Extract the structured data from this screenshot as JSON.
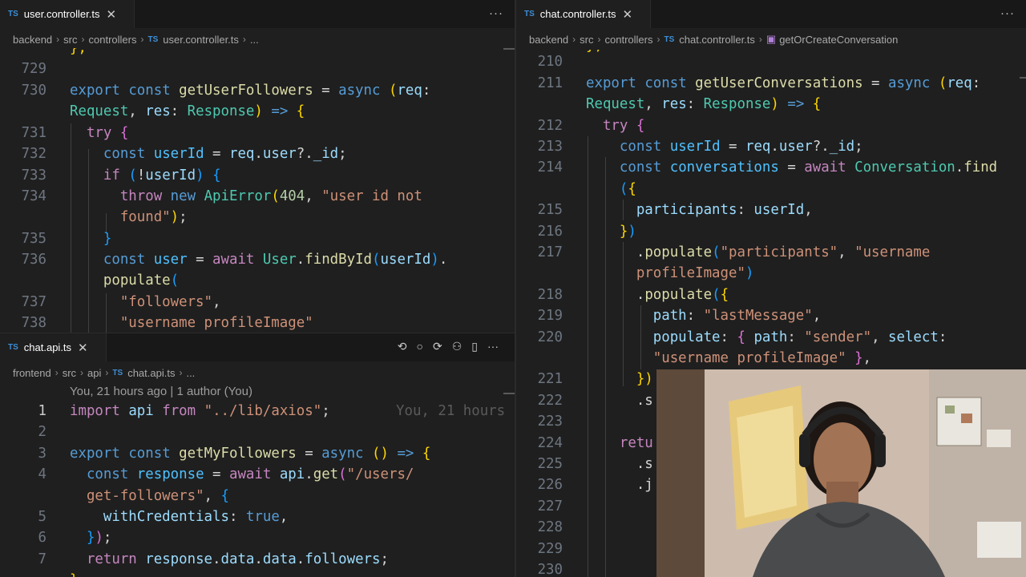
{
  "left_top": {
    "tab": {
      "lang": "TS",
      "name": "user.controller.ts",
      "close": "✕"
    },
    "more": "···",
    "breadcrumb": [
      "backend",
      "src",
      "controllers",
      "TS",
      "user.controller.ts",
      "..."
    ]
  },
  "left_bottom": {
    "tab": {
      "lang": "TS",
      "name": "chat.api.ts",
      "close": "✕"
    },
    "breadcrumb": [
      "frontend",
      "src",
      "api",
      "TS",
      "chat.api.ts",
      "..."
    ],
    "blame": "You, 21 hours ago | 1 author (You)",
    "inline_blame": "You, 21 hours",
    "actions": [
      "⟲",
      "○",
      "⟳",
      "⚇",
      "▯",
      "···"
    ]
  },
  "right": {
    "tab": {
      "lang": "TS",
      "name": "chat.controller.ts",
      "close": "✕"
    },
    "more": "···",
    "breadcrumb": [
      "backend",
      "src",
      "controllers",
      "TS",
      "chat.controller.ts",
      "getOrCreateConversation"
    ]
  },
  "line_numbers": {
    "left_top": [
      "729",
      "730",
      "",
      "731",
      "732",
      "733",
      "734",
      "",
      "735",
      "736",
      "",
      "737",
      "738"
    ],
    "left_bottom": [
      "1",
      "2",
      "3",
      "4",
      "",
      "5",
      "6",
      "7"
    ],
    "right": [
      "210",
      "211",
      "",
      "212",
      "213",
      "214",
      "",
      "215",
      "216",
      "217",
      "",
      "218",
      "219",
      "220",
      "",
      "221",
      "222",
      "223",
      "224",
      "225",
      "226",
      "227",
      "228",
      "229",
      "230"
    ]
  },
  "code": {
    "lt_0": "};",
    "lt_1a": "export",
    "lt_1b": "const",
    "lt_1c": "getUserFollowers",
    "lt_1d": " = ",
    "lt_1e": "async",
    "lt_1f": "(",
    "lt_1g": "req",
    "lt_2a": "Request",
    "lt_2b": ", ",
    "lt_2c": "res",
    "lt_2d": "Response",
    "lt_2e": ")",
    "lt_2f": "=>",
    "lt_2g": "{",
    "lt_3a": "try",
    "lt_3b": "{",
    "lt_4a": "const",
    "lt_4b": "userId",
    "lt_4c": "req",
    "lt_4d": "user",
    "lt_4e": "_id",
    "lt_5a": "if",
    "lt_5b": "(",
    "lt_5c": "!",
    "lt_5d": "userId",
    "lt_5e": ")",
    "lt_5f": "{",
    "lt_6a": "throw",
    "lt_6b": "new",
    "lt_6c": "ApiError",
    "lt_6d": "(",
    "lt_6e": "404",
    "lt_6f": "\"user id not",
    "lt_7a": "found\"",
    "lt_7b": ")",
    "lt_8a": "}",
    "lt_9a": "const",
    "lt_9b": "user",
    "lt_9c": "await",
    "lt_9d": "User",
    "lt_9e": "findById",
    "lt_9f": "(",
    "lt_9g": "userId",
    "lt_9h": ")",
    "lt_10a": "populate",
    "lt_10b": "(",
    "lt_11a": "\"followers\"",
    "lt_12a": "\"username profileImage\"",
    "lb_0a": "import",
    "lb_0b": "api",
    "lb_0c": "from",
    "lb_0d": "\"../lib/axios\"",
    "lb_2a": "export",
    "lb_2b": "const",
    "lb_2c": "getMyFollowers",
    "lb_2d": "async",
    "lb_2e": "()",
    "lb_2f": "=>",
    "lb_2g": "{",
    "lb_3a": "const",
    "lb_3b": "response",
    "lb_3c": "await",
    "lb_3d": "api",
    "lb_3e": "get",
    "lb_3f": "(",
    "lb_3g": "\"/users/",
    "lb_4a": "get-followers\"",
    "lb_4b": "{",
    "lb_5a": "withCredentials",
    "lb_5b": "true",
    "lb_6a": "}",
    "lb_6b": ")",
    "lb_7a": "return",
    "lb_7b": "response",
    "lb_7c": "data",
    "lb_7d": "data",
    "lb_7e": "followers",
    "r_1a": "export",
    "r_1b": "const",
    "r_1c": "getUserConversations",
    "r_1d": "async",
    "r_1e": "(",
    "r_1f": "req",
    "r_2a": "Request",
    "r_2b": "res",
    "r_2c": "Response",
    "r_2d": ")",
    "r_2e": "=>",
    "r_2f": "{",
    "r_3a": "try",
    "r_3b": "{",
    "r_4a": "const",
    "r_4b": "userId",
    "r_4c": "req",
    "r_4d": "user",
    "r_4e": "_id",
    "r_5a": "const",
    "r_5b": "conversations",
    "r_5c": "await",
    "r_5d": "Conversation",
    "r_5e": "find",
    "r_6a": "(",
    "r_6b": "{",
    "r_7a": "participants",
    "r_7b": "userId",
    "r_8a": "}",
    "r_8b": ")",
    "r_9a": "populate",
    "r_9b": "(",
    "r_9c": "\"participants\"",
    "r_9d": "\"username",
    "r_10a": "profileImage\"",
    "r_10b": ")",
    "r_11a": "populate",
    "r_11b": "(",
    "r_11c": "{",
    "r_12a": "path",
    "r_12b": "\"lastMessage\"",
    "r_13a": "populate",
    "r_13b": "{",
    "r_13c": "path",
    "r_13d": "\"sender\"",
    "r_13e": "select",
    "r_14a": "\"username profileImage\"",
    "r_14b": "}",
    "r_15a": "})",
    "r_16a": ".s",
    "r_18a": "retu",
    "r_19a": ".s",
    "r_20a": ".j"
  },
  "webcam": {
    "label": "webcam-feed"
  }
}
